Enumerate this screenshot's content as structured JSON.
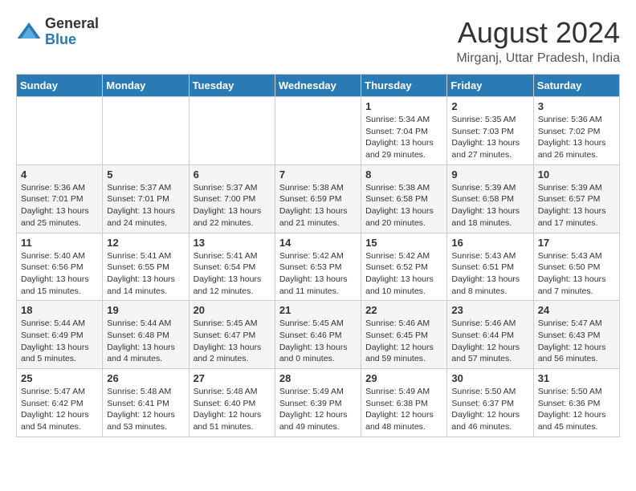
{
  "header": {
    "logo_line1": "General",
    "logo_line2": "Blue",
    "title": "August 2024",
    "location": "Mirganj, Uttar Pradesh, India"
  },
  "weekdays": [
    "Sunday",
    "Monday",
    "Tuesday",
    "Wednesday",
    "Thursday",
    "Friday",
    "Saturday"
  ],
  "weeks": [
    [
      {
        "day": "",
        "info": ""
      },
      {
        "day": "",
        "info": ""
      },
      {
        "day": "",
        "info": ""
      },
      {
        "day": "",
        "info": ""
      },
      {
        "day": "1",
        "info": "Sunrise: 5:34 AM\nSunset: 7:04 PM\nDaylight: 13 hours\nand 29 minutes."
      },
      {
        "day": "2",
        "info": "Sunrise: 5:35 AM\nSunset: 7:03 PM\nDaylight: 13 hours\nand 27 minutes."
      },
      {
        "day": "3",
        "info": "Sunrise: 5:36 AM\nSunset: 7:02 PM\nDaylight: 13 hours\nand 26 minutes."
      }
    ],
    [
      {
        "day": "4",
        "info": "Sunrise: 5:36 AM\nSunset: 7:01 PM\nDaylight: 13 hours\nand 25 minutes."
      },
      {
        "day": "5",
        "info": "Sunrise: 5:37 AM\nSunset: 7:01 PM\nDaylight: 13 hours\nand 24 minutes."
      },
      {
        "day": "6",
        "info": "Sunrise: 5:37 AM\nSunset: 7:00 PM\nDaylight: 13 hours\nand 22 minutes."
      },
      {
        "day": "7",
        "info": "Sunrise: 5:38 AM\nSunset: 6:59 PM\nDaylight: 13 hours\nand 21 minutes."
      },
      {
        "day": "8",
        "info": "Sunrise: 5:38 AM\nSunset: 6:58 PM\nDaylight: 13 hours\nand 20 minutes."
      },
      {
        "day": "9",
        "info": "Sunrise: 5:39 AM\nSunset: 6:58 PM\nDaylight: 13 hours\nand 18 minutes."
      },
      {
        "day": "10",
        "info": "Sunrise: 5:39 AM\nSunset: 6:57 PM\nDaylight: 13 hours\nand 17 minutes."
      }
    ],
    [
      {
        "day": "11",
        "info": "Sunrise: 5:40 AM\nSunset: 6:56 PM\nDaylight: 13 hours\nand 15 minutes."
      },
      {
        "day": "12",
        "info": "Sunrise: 5:41 AM\nSunset: 6:55 PM\nDaylight: 13 hours\nand 14 minutes."
      },
      {
        "day": "13",
        "info": "Sunrise: 5:41 AM\nSunset: 6:54 PM\nDaylight: 13 hours\nand 12 minutes."
      },
      {
        "day": "14",
        "info": "Sunrise: 5:42 AM\nSunset: 6:53 PM\nDaylight: 13 hours\nand 11 minutes."
      },
      {
        "day": "15",
        "info": "Sunrise: 5:42 AM\nSunset: 6:52 PM\nDaylight: 13 hours\nand 10 minutes."
      },
      {
        "day": "16",
        "info": "Sunrise: 5:43 AM\nSunset: 6:51 PM\nDaylight: 13 hours\nand 8 minutes."
      },
      {
        "day": "17",
        "info": "Sunrise: 5:43 AM\nSunset: 6:50 PM\nDaylight: 13 hours\nand 7 minutes."
      }
    ],
    [
      {
        "day": "18",
        "info": "Sunrise: 5:44 AM\nSunset: 6:49 PM\nDaylight: 13 hours\nand 5 minutes."
      },
      {
        "day": "19",
        "info": "Sunrise: 5:44 AM\nSunset: 6:48 PM\nDaylight: 13 hours\nand 4 minutes."
      },
      {
        "day": "20",
        "info": "Sunrise: 5:45 AM\nSunset: 6:47 PM\nDaylight: 13 hours\nand 2 minutes."
      },
      {
        "day": "21",
        "info": "Sunrise: 5:45 AM\nSunset: 6:46 PM\nDaylight: 13 hours\nand 0 minutes."
      },
      {
        "day": "22",
        "info": "Sunrise: 5:46 AM\nSunset: 6:45 PM\nDaylight: 12 hours\nand 59 minutes."
      },
      {
        "day": "23",
        "info": "Sunrise: 5:46 AM\nSunset: 6:44 PM\nDaylight: 12 hours\nand 57 minutes."
      },
      {
        "day": "24",
        "info": "Sunrise: 5:47 AM\nSunset: 6:43 PM\nDaylight: 12 hours\nand 56 minutes."
      }
    ],
    [
      {
        "day": "25",
        "info": "Sunrise: 5:47 AM\nSunset: 6:42 PM\nDaylight: 12 hours\nand 54 minutes."
      },
      {
        "day": "26",
        "info": "Sunrise: 5:48 AM\nSunset: 6:41 PM\nDaylight: 12 hours\nand 53 minutes."
      },
      {
        "day": "27",
        "info": "Sunrise: 5:48 AM\nSunset: 6:40 PM\nDaylight: 12 hours\nand 51 minutes."
      },
      {
        "day": "28",
        "info": "Sunrise: 5:49 AM\nSunset: 6:39 PM\nDaylight: 12 hours\nand 49 minutes."
      },
      {
        "day": "29",
        "info": "Sunrise: 5:49 AM\nSunset: 6:38 PM\nDaylight: 12 hours\nand 48 minutes."
      },
      {
        "day": "30",
        "info": "Sunrise: 5:50 AM\nSunset: 6:37 PM\nDaylight: 12 hours\nand 46 minutes."
      },
      {
        "day": "31",
        "info": "Sunrise: 5:50 AM\nSunset: 6:36 PM\nDaylight: 12 hours\nand 45 minutes."
      }
    ]
  ]
}
